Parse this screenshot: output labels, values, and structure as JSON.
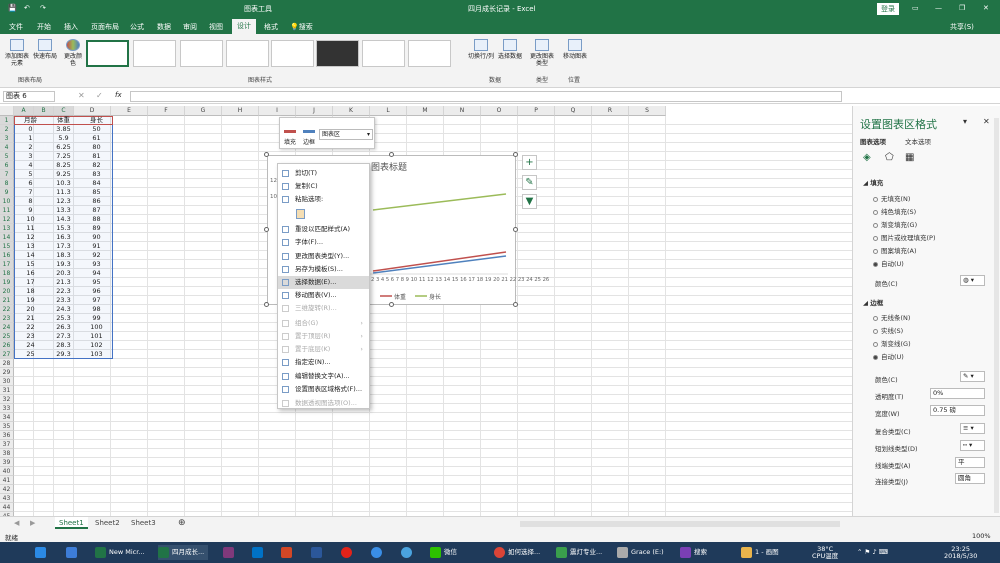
{
  "window": {
    "title": "四月成长记录 - Excel",
    "context_tab": "图表工具",
    "login": "登录",
    "share": "共享(S)"
  },
  "ribbon_tabs": [
    "文件",
    "开始",
    "插入",
    "页面布局",
    "公式",
    "数据",
    "审阅",
    "视图",
    "设计",
    "格式"
  ],
  "ribbon_search": "搜索",
  "ribbon": {
    "add_element": "添加图表元素",
    "quick_layout": "快速布局",
    "change_colors": "更改颜色",
    "switch_rowcol": "切换行/列",
    "select_data": "选择数据",
    "change_type": "更改图表类型",
    "move_chart": "移动图表",
    "groups": {
      "layout": "图表布局",
      "styles": "图表样式",
      "data": "数据",
      "type": "类型",
      "location": "位置"
    }
  },
  "name_box": "图表 6",
  "fx": "fx",
  "columns": [
    "A",
    "B",
    "C",
    "D",
    "E",
    "F",
    "G",
    "H",
    "I",
    "J",
    "K",
    "L",
    "M",
    "N",
    "O",
    "P",
    "Q",
    "R",
    "S"
  ],
  "headers": [
    "月龄",
    "体重",
    "身长"
  ],
  "rows": [
    [
      "0",
      "3.85",
      "50"
    ],
    [
      "1",
      "5.9",
      "61"
    ],
    [
      "2",
      "6.25",
      "80"
    ],
    [
      "3",
      "7.25",
      "81"
    ],
    [
      "4",
      "8.25",
      "82"
    ],
    [
      "5",
      "9.25",
      "83"
    ],
    [
      "6",
      "10.3",
      "84"
    ],
    [
      "7",
      "11.3",
      "85"
    ],
    [
      "8",
      "12.3",
      "86"
    ],
    [
      "9",
      "13.3",
      "87"
    ],
    [
      "10",
      "14.3",
      "88"
    ],
    [
      "11",
      "15.3",
      "89"
    ],
    [
      "12",
      "16.3",
      "90"
    ],
    [
      "13",
      "17.3",
      "91"
    ],
    [
      "14",
      "18.3",
      "92"
    ],
    [
      "15",
      "19.3",
      "93"
    ],
    [
      "16",
      "20.3",
      "94"
    ],
    [
      "17",
      "21.3",
      "95"
    ],
    [
      "18",
      "22.3",
      "96"
    ],
    [
      "19",
      "23.3",
      "97"
    ],
    [
      "20",
      "24.3",
      "98"
    ],
    [
      "21",
      "25.3",
      "99"
    ],
    [
      "22",
      "26.3",
      "100"
    ],
    [
      "23",
      "27.3",
      "101"
    ],
    [
      "24",
      "28.3",
      "102"
    ],
    [
      "25",
      "29.3",
      "103"
    ]
  ],
  "row_count": 47,
  "chart": {
    "title": "图表标题",
    "xlabels": "2 3 4 5 6 7 8 9 10 11 12 13 14 15 16 17 18 19 20 21 22 23 24 25 26",
    "legend": [
      "体重",
      "身长"
    ],
    "y_tick_1": "120",
    "y_tick_2": "10"
  },
  "mini_toolbar": {
    "fill": "填充",
    "outline": "边框",
    "area": "图表区"
  },
  "context_menu": [
    {
      "label": "剪切(T)",
      "state": "normal"
    },
    {
      "label": "复制(C)",
      "state": "normal"
    },
    {
      "label": "粘贴选项:",
      "state": "normal"
    },
    {
      "label": "",
      "state": "paste"
    },
    {
      "label": "重设以匹配样式(A)",
      "state": "normal"
    },
    {
      "label": "字体(F)...",
      "state": "normal"
    },
    {
      "label": "更改图表类型(Y)...",
      "state": "normal"
    },
    {
      "label": "另存为模板(S)...",
      "state": "normal"
    },
    {
      "label": "选择数据(E)...",
      "state": "highlight"
    },
    {
      "label": "移动图表(V)...",
      "state": "normal"
    },
    {
      "label": "三维旋转(R)...",
      "state": "disabled"
    },
    {
      "label": "组合(G)",
      "state": "disabled"
    },
    {
      "label": "置于顶层(R)",
      "state": "disabled"
    },
    {
      "label": "置于底层(K)",
      "state": "disabled"
    },
    {
      "label": "指定宏(N)...",
      "state": "normal"
    },
    {
      "label": "编辑替换文字(A)...",
      "state": "normal"
    },
    {
      "label": "设置图表区域格式(F)...",
      "state": "normal"
    },
    {
      "label": "数据透视图选项(O)...",
      "state": "disabled"
    }
  ],
  "pane": {
    "title": "设置图表区格式",
    "tab_chart": "图表选项",
    "tab_text": "文本选项",
    "fill_header": "填充",
    "fill_options": [
      "无填充(N)",
      "纯色填充(S)",
      "渐变填充(G)",
      "图片或纹理填充(P)",
      "图案填充(A)",
      "自动(U)"
    ],
    "fill_selected": 5,
    "color": "颜色(C)",
    "border_header": "边框",
    "border_options": [
      "无线条(N)",
      "实线(S)",
      "渐变线(G)",
      "自动(U)"
    ],
    "border_selected": 3,
    "border_color": "颜色(C)",
    "transparency": "透明度(T)",
    "transparency_value": "0%",
    "width": "宽度(W)",
    "width_value": "0.75 磅",
    "compound": "复合类型(C)",
    "dash": "短划线类型(D)",
    "cap": "线端类型(A)",
    "cap_value": "平",
    "join": "连接类型(J)",
    "join_value": "圆角"
  },
  "sheets": [
    "Sheet1",
    "Sheet2",
    "Sheet3"
  ],
  "status": {
    "left": "就绪",
    "zoom": "100%"
  },
  "taskbar": {
    "items": [
      "New Micr...",
      "四月成长...",
      "",
      "",
      "",
      "",
      "",
      "",
      "微信",
      "如何选择...",
      "震灯专业...",
      "Grace (E:)",
      "搜索",
      "1 - 画图"
    ],
    "temp": "38°C",
    "temp_label": "CPU温度",
    "time": "23:25",
    "date": "2018/5/30"
  },
  "colors": {
    "excel_green": "#217346",
    "series1": "#c0504d",
    "series2": "#9bbb59",
    "series3": "#4f81bd"
  }
}
